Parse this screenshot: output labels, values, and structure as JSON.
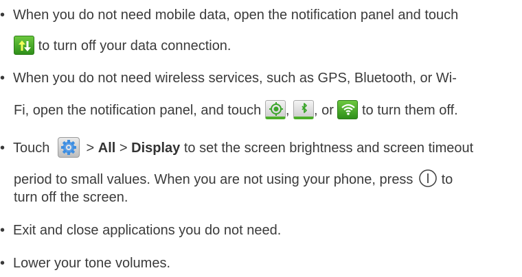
{
  "bullets": [
    {
      "lines": [
        "When you do not need mobile data, open the notification panel and touch",
        "to turn off your data connection."
      ]
    },
    {
      "lines": [
        "When you do not need wireless services, such as GPS, Bluetooth, or Wi-",
        "Fi, open the notification panel, and touch",
        ",",
        ", or",
        "to turn them off."
      ]
    },
    {
      "parts": {
        "touch": "Touch",
        "sep1": ">",
        "all": "All",
        "sep2": ">",
        "display": "Display",
        "rest": "to set the screen brightness and screen timeout"
      },
      "lines": [
        "period to small values. When you are not using your phone, press",
        "to",
        "turn off the screen."
      ]
    },
    {
      "lines": [
        "Exit and close applications you do not need."
      ]
    },
    {
      "lines": [
        "Lower your tone volumes."
      ]
    }
  ],
  "bullet_char": "•",
  "icons": {
    "data": "mobile-data-icon",
    "gps": "gps-icon",
    "bluetooth": "bluetooth-icon",
    "wifi": "wifi-icon",
    "settings": "settings-gear-icon",
    "power": "power-button-icon"
  },
  "colors": {
    "text": "#3a3a3a",
    "icon_green": "#4caf2a",
    "icon_green_dark": "#2e7d18"
  }
}
